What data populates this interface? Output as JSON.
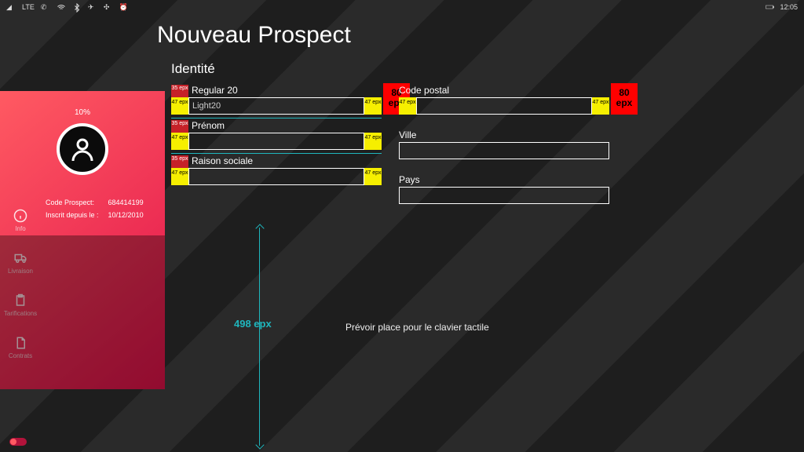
{
  "statusbar": {
    "signal": "LTE",
    "clock": "12:05"
  },
  "page": {
    "title": "Nouveau Prospect",
    "section": "Identité"
  },
  "profile": {
    "percent": "10%",
    "code_label": "Code Prospect:",
    "code_value": "684414199",
    "since_label": "Inscrit depuis le :",
    "since_value": "10/12/2010"
  },
  "nav": {
    "info": "Info",
    "delivery": "Livraison",
    "pricing": "Tarifications",
    "contracts": "Contrats"
  },
  "redline": {
    "tag35": "35 epx",
    "tag47": "47 epx",
    "tag80": "80 epx",
    "kb_height": "498 epx"
  },
  "form": {
    "left": {
      "f1_label": "Regular 20",
      "f1_value": "Light20",
      "f2_label": "Prénom",
      "f2_value": "",
      "f3_label": "Raison sociale",
      "f3_value": ""
    },
    "right": {
      "f1_label": "Code postal",
      "f1_value": "",
      "f2_label": "Ville",
      "f2_value": "",
      "f3_label": "Pays",
      "f3_value": ""
    }
  },
  "keyboard_hint": "Prévoir place pour le clavier tactile"
}
